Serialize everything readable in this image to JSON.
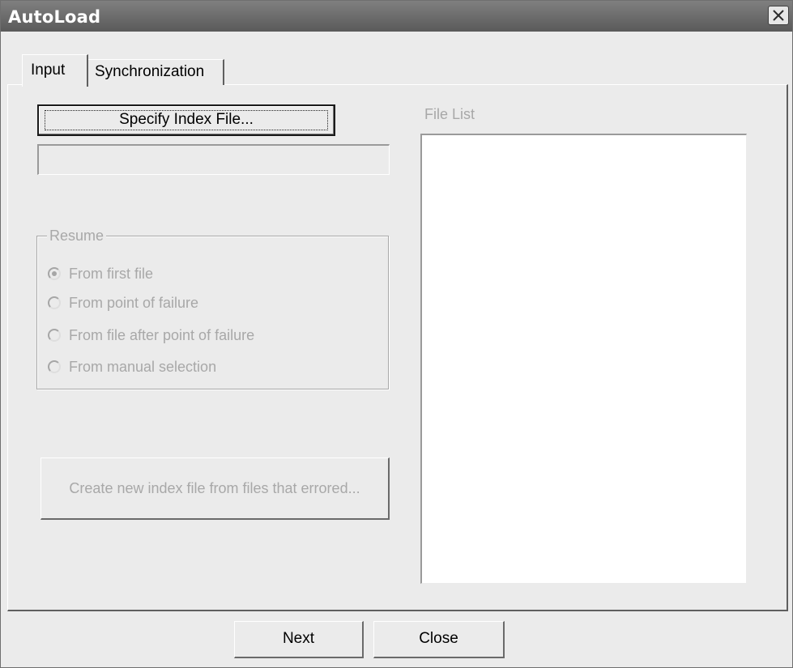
{
  "window": {
    "title": "AutoLoad",
    "close_icon": "close-icon"
  },
  "tabs": [
    {
      "label": "Input",
      "selected": true
    },
    {
      "label": "Synchronization",
      "selected": false
    }
  ],
  "input_tab": {
    "specify_index_button": "Specify Index File...",
    "index_file_path": "",
    "file_list_label": "File List",
    "file_list_items": [],
    "resume": {
      "legend": "Resume",
      "options": [
        {
          "label": "From first file",
          "checked": true
        },
        {
          "label": "From point of failure",
          "checked": false
        },
        {
          "label": "From file after point of failure",
          "checked": false
        },
        {
          "label": "From manual selection",
          "checked": false
        }
      ],
      "enabled": false
    },
    "create_index_button": "Create new index file from files that errored..."
  },
  "footer": {
    "next_label": "Next",
    "close_label": "Close"
  },
  "colors": {
    "title_bar": "#6b6b6b",
    "window_bg": "#ebebeb",
    "disabled_text": "#a8a8a8"
  }
}
